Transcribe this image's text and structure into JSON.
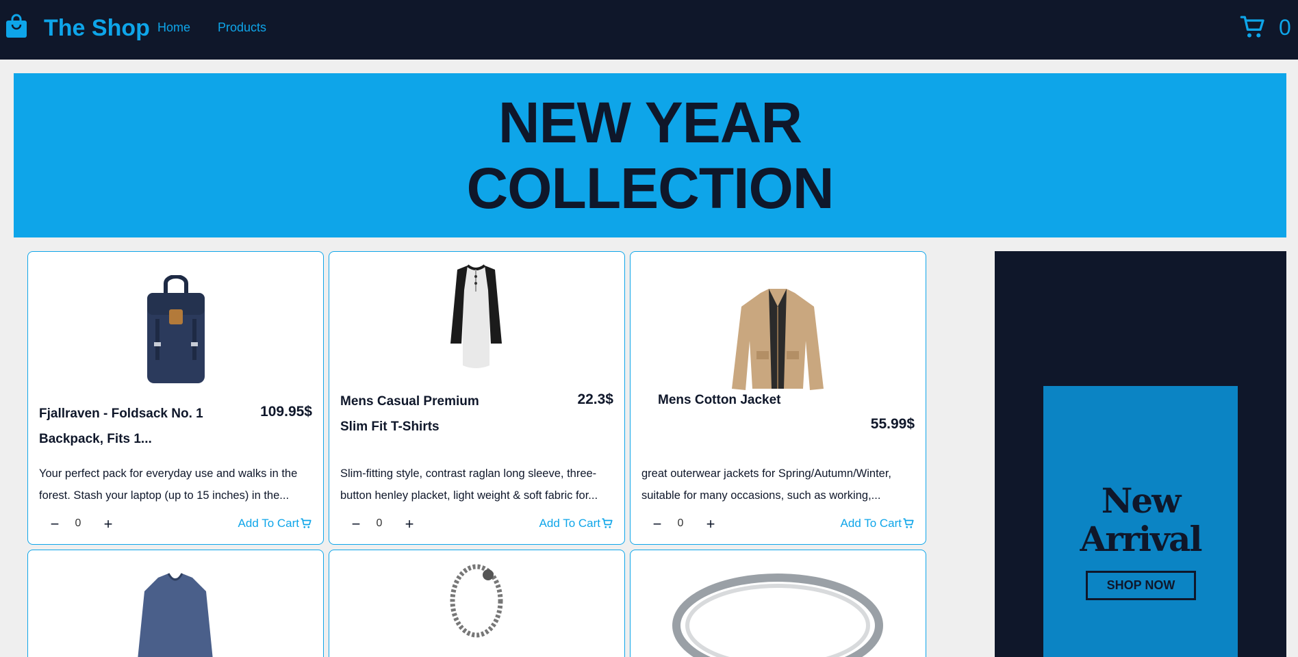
{
  "nav": {
    "brand": "The Shop",
    "links": [
      "Home",
      "Products"
    ],
    "cart_count": "0",
    "brand_color": "#0ea5e9",
    "bg_color": "#0f172a"
  },
  "hero": {
    "title": "NEW YEAR COLLECTION",
    "bg_color": "#0ea5e9"
  },
  "products": [
    {
      "title": "Fjallraven - Foldsack No. 1 Backpack, Fits 1...",
      "price": "109.95$",
      "description": "Your perfect pack for everyday use and walks in the forest. Stash your laptop (up to 15 inches) in the...",
      "quantity": "0",
      "cta": "Add To Cart",
      "image": "backpack"
    },
    {
      "title": "Mens Casual Premium Slim Fit T-Shirts",
      "price": "22.3$",
      "description": "Slim-fitting style, contrast raglan long sleeve, three-button henley placket, light weight & soft fabric for...",
      "quantity": "0",
      "cta": "Add To Cart",
      "image": "henley-shirt"
    },
    {
      "title": "Mens Cotton Jacket",
      "price": "55.99$",
      "description": "great outerwear jackets for Spring/Autumn/Winter, suitable for many occasions, such as working,...",
      "quantity": "0",
      "cta": "Add To Cart",
      "image": "cotton-jacket"
    },
    {
      "image": "long-sleeve-shirt"
    },
    {
      "image": "chain-bracelet"
    },
    {
      "image": "silver-ring"
    }
  ],
  "ad": {
    "title": "New Arrival",
    "button": "SHOP NOW"
  }
}
